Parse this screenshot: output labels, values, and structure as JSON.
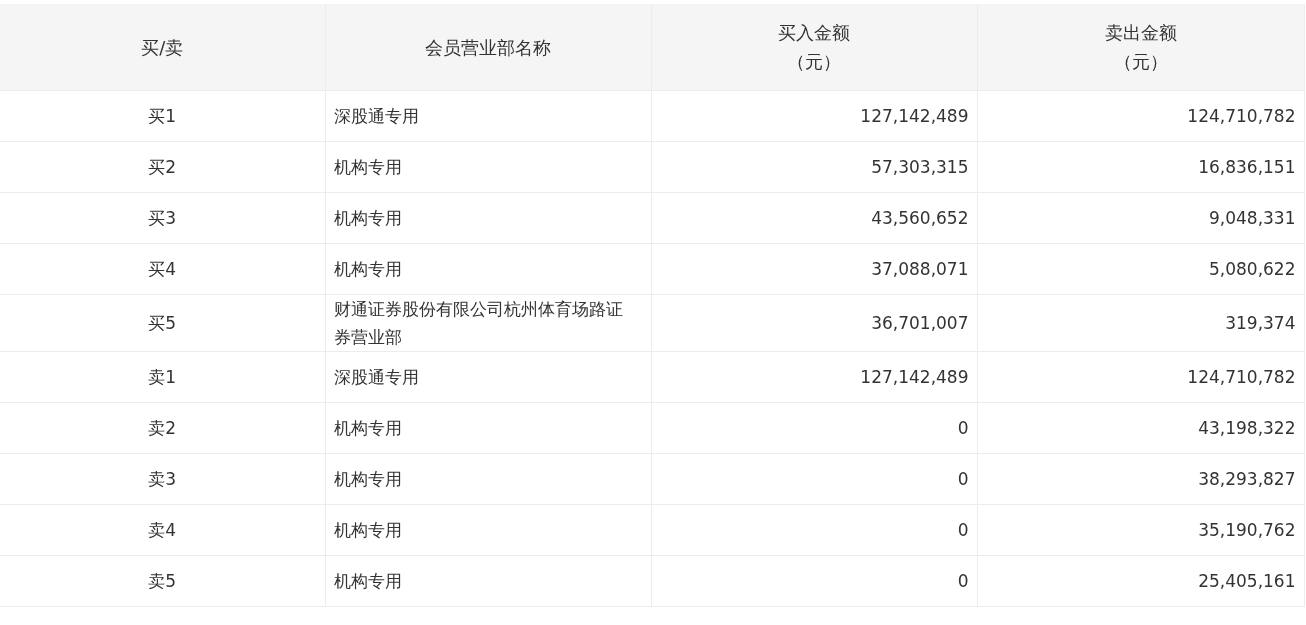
{
  "table": {
    "columns": [
      {
        "label": "买/卖"
      },
      {
        "label": "会员营业部名称"
      },
      {
        "label": "买入金额",
        "unit": "（元）"
      },
      {
        "label": "卖出金额",
        "unit": "（元）"
      }
    ],
    "rows": [
      {
        "side": "买1",
        "name": "深股通专用",
        "buy": "127,142,489",
        "sell": "124,710,782"
      },
      {
        "side": "买2",
        "name": "机构专用",
        "buy": "57,303,315",
        "sell": "16,836,151"
      },
      {
        "side": "买3",
        "name": "机构专用",
        "buy": "43,560,652",
        "sell": "9,048,331"
      },
      {
        "side": "买4",
        "name": "机构专用",
        "buy": "37,088,071",
        "sell": "5,080,622"
      },
      {
        "side": "买5",
        "name": "财通证券股份有限公司杭州体育场路证券营业部",
        "buy": "36,701,007",
        "sell": "319,374"
      },
      {
        "side": "卖1",
        "name": "深股通专用",
        "buy": "127,142,489",
        "sell": "124,710,782"
      },
      {
        "side": "卖2",
        "name": "机构专用",
        "buy": "0",
        "sell": "43,198,322"
      },
      {
        "side": "卖3",
        "name": "机构专用",
        "buy": "0",
        "sell": "38,293,827"
      },
      {
        "side": "卖4",
        "name": "机构专用",
        "buy": "0",
        "sell": "35,190,762"
      },
      {
        "side": "卖5",
        "name": "机构专用",
        "buy": "0",
        "sell": "25,405,161"
      }
    ]
  }
}
